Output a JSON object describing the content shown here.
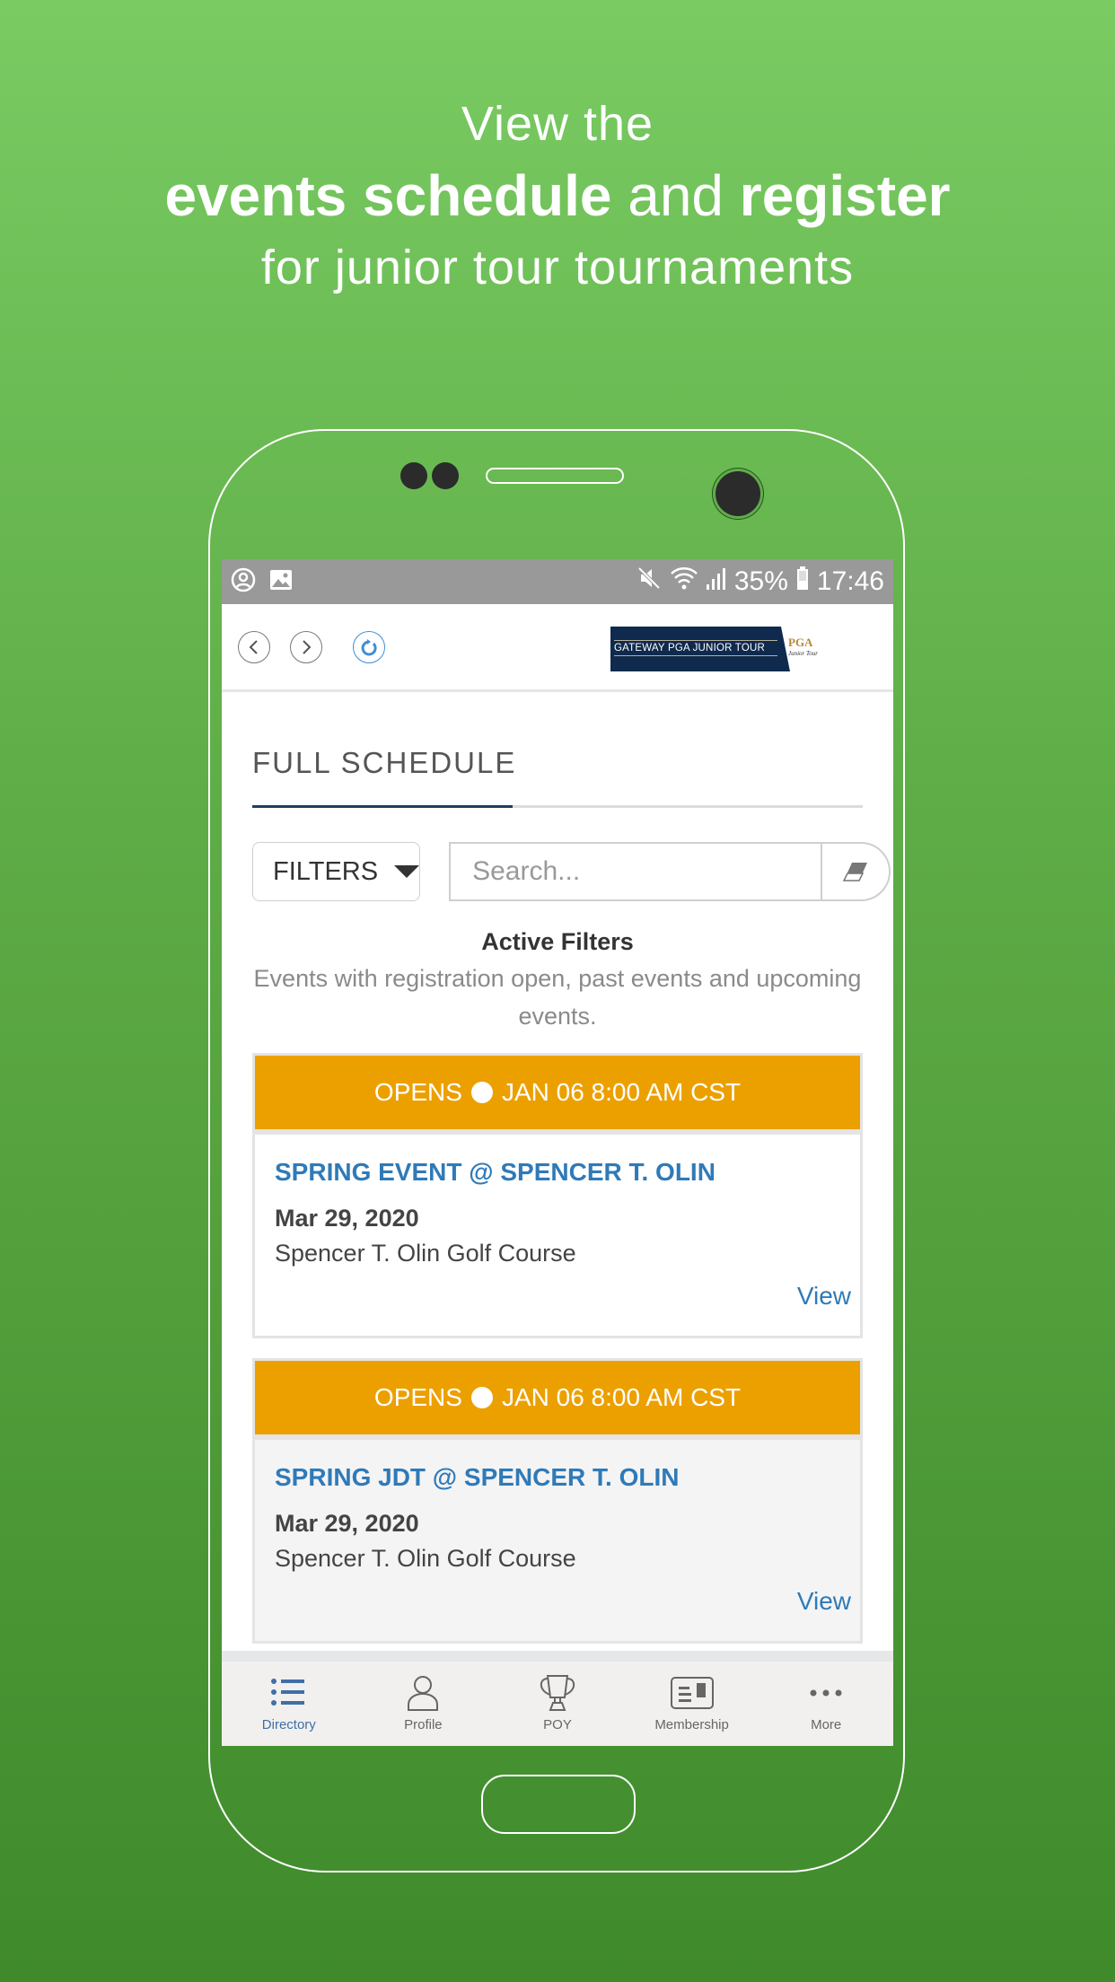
{
  "headline": {
    "line1": "View the",
    "line2_bold1": "events schedule",
    "line2_mid": "and",
    "line2_bold2": "register",
    "line3": "for junior tour tournaments"
  },
  "statusbar": {
    "left_icons": [
      "account-circle-icon",
      "image-icon"
    ],
    "right_icons": [
      "mute-icon",
      "wifi-icon",
      "signal-icon",
      "battery-icon"
    ],
    "battery": "35%",
    "time": "17:46"
  },
  "topnav": {
    "back_icon": "chevron-left-icon",
    "forward_icon": "chevron-right-icon",
    "refresh_icon": "refresh-icon",
    "logo_text": "GATEWAY PGA JUNIOR TOUR",
    "pga_text": "PGA",
    "pga_sub": "Junior Tour"
  },
  "page": {
    "title": "FULL SCHEDULE",
    "filters_label": "FILTERS",
    "search_placeholder": "Search...",
    "search_value": "",
    "active_filters_title": "Active Filters",
    "active_filters_desc": "Events with registration open, past events and upcoming events."
  },
  "events": [
    {
      "opens_label": "OPENS",
      "opens_time": "JAN 06 8:00 AM CST",
      "name": "SPRING EVENT @ SPENCER T. OLIN",
      "date": "Mar 29, 2020",
      "venue": "Spencer T. Olin Golf Course",
      "view_label": "View"
    },
    {
      "opens_label": "OPENS",
      "opens_time": "JAN 06 8:00 AM CST",
      "name": "SPRING JDT @ SPENCER T. OLIN",
      "date": "Mar 29, 2020",
      "venue": "Spencer T. Olin Golf Course",
      "view_label": "View"
    }
  ],
  "bottomnav": {
    "items": [
      {
        "label": "Directory",
        "icon": "list-icon",
        "active": true
      },
      {
        "label": "Profile",
        "icon": "person-icon",
        "active": false
      },
      {
        "label": "POY",
        "icon": "trophy-icon",
        "active": false
      },
      {
        "label": "Membership",
        "icon": "membership-card-icon",
        "active": false
      },
      {
        "label": "More",
        "icon": "more-dots-icon",
        "active": false
      }
    ]
  },
  "colors": {
    "accent_blue": "#2f7ab8",
    "banner_orange": "#eca000",
    "nav_active": "#3f6fa6",
    "background_green_top": "#79cb62",
    "background_green_bottom": "#3f8a2b"
  }
}
